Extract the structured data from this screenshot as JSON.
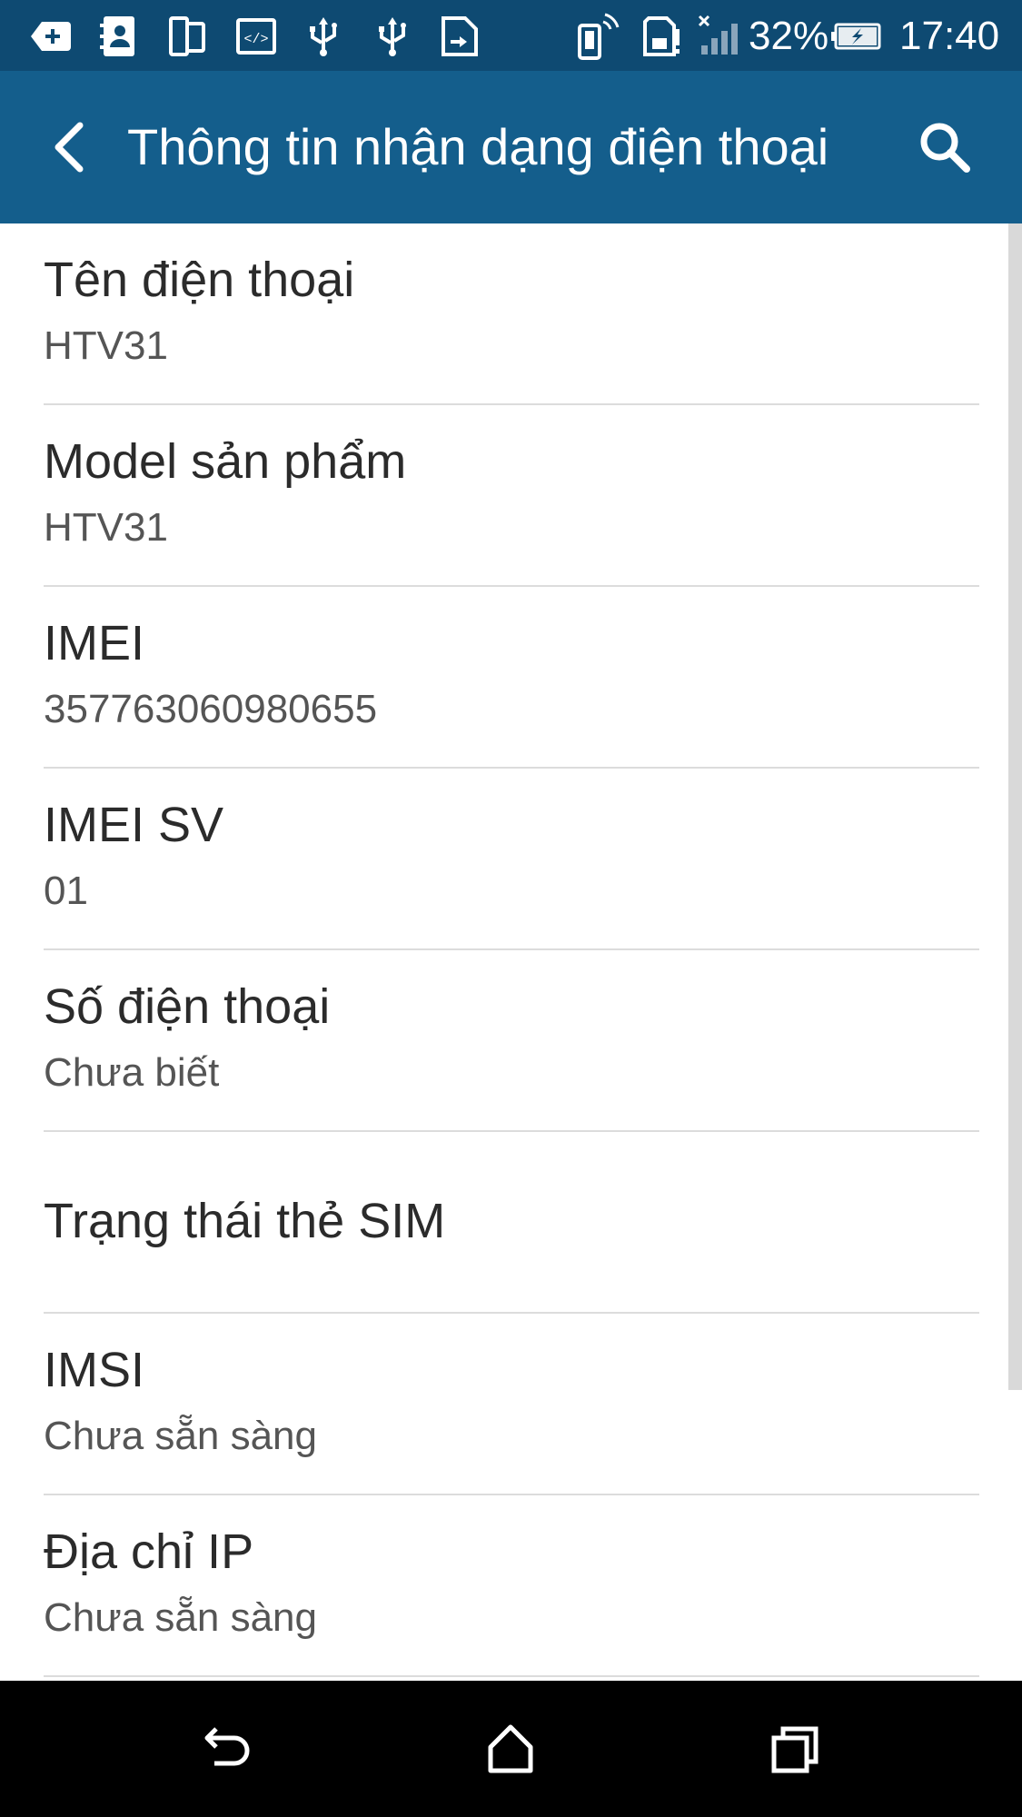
{
  "status_bar": {
    "battery_percent": "32%",
    "time": "17:40",
    "icons": [
      "add-box-icon",
      "contacts-icon",
      "phone-tablet-icon",
      "code-icon",
      "usb-icon",
      "usb-icon",
      "file-transfer-icon",
      "vibrate-phone-icon",
      "sd-card-alert-icon",
      "signal-no-service-icon",
      "battery-charging-icon"
    ]
  },
  "app_bar": {
    "title": "Thông tin nhận dạng điện thoại",
    "back_icon": "back-arrow-icon",
    "search_icon": "search-icon"
  },
  "items": [
    {
      "title": "Tên điện thoại",
      "value": "HTV31"
    },
    {
      "title": "Model sản phẩm",
      "value": "HTV31"
    },
    {
      "title": "IMEI",
      "value": "357763060980655"
    },
    {
      "title": "IMEI SV",
      "value": "01"
    },
    {
      "title": "Số điện thoại",
      "value": "Chưa biết"
    },
    {
      "title": "Trạng thái thẻ SIM",
      "value": ""
    },
    {
      "title": "IMSI",
      "value": "Chưa sẵn sàng"
    },
    {
      "title": "Địa chỉ IP",
      "value": "Chưa sẵn sàng"
    }
  ],
  "nav_bar": {
    "icons": [
      "nav-back-icon",
      "nav-home-icon",
      "nav-recents-icon"
    ]
  },
  "colors": {
    "status_bar": "#0e4a72",
    "app_bar": "#145e8c",
    "nav_bar": "#000000"
  }
}
